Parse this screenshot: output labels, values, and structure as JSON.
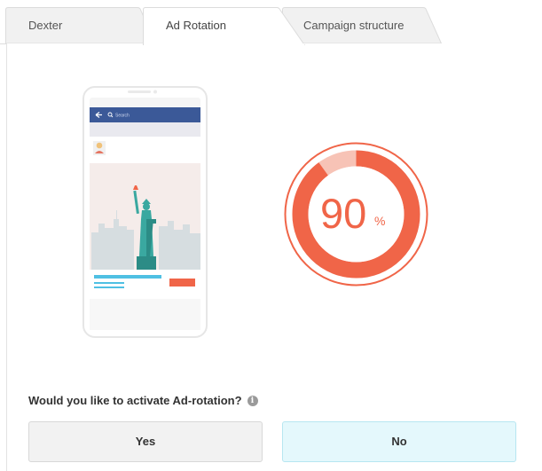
{
  "tabs": [
    {
      "id": "dexter",
      "label": "Dexter",
      "active": false
    },
    {
      "id": "ad_rotation",
      "label": "Ad Rotation",
      "active": true
    },
    {
      "id": "campaign_structure",
      "label": "Campaign structure",
      "active": false
    }
  ],
  "preview": {
    "search_placeholder": "Search",
    "illustration": "statue-of-liberty-skyline"
  },
  "gauge": {
    "value": 90,
    "number_text": "90",
    "unit": "%"
  },
  "question": {
    "text": "Would you like to activate Ad-rotation?",
    "info_icon": "info-icon"
  },
  "buttons": {
    "yes_label": "Yes",
    "no_label": "No"
  },
  "colors": {
    "accent": "#f06548",
    "accent_light": "#f7c3b6",
    "facebook_blue": "#3b5998",
    "statue_teal": "#3aa8a0",
    "no_button_bg": "#e4f8fc",
    "yes_button_bg": "#f2f2f2"
  }
}
